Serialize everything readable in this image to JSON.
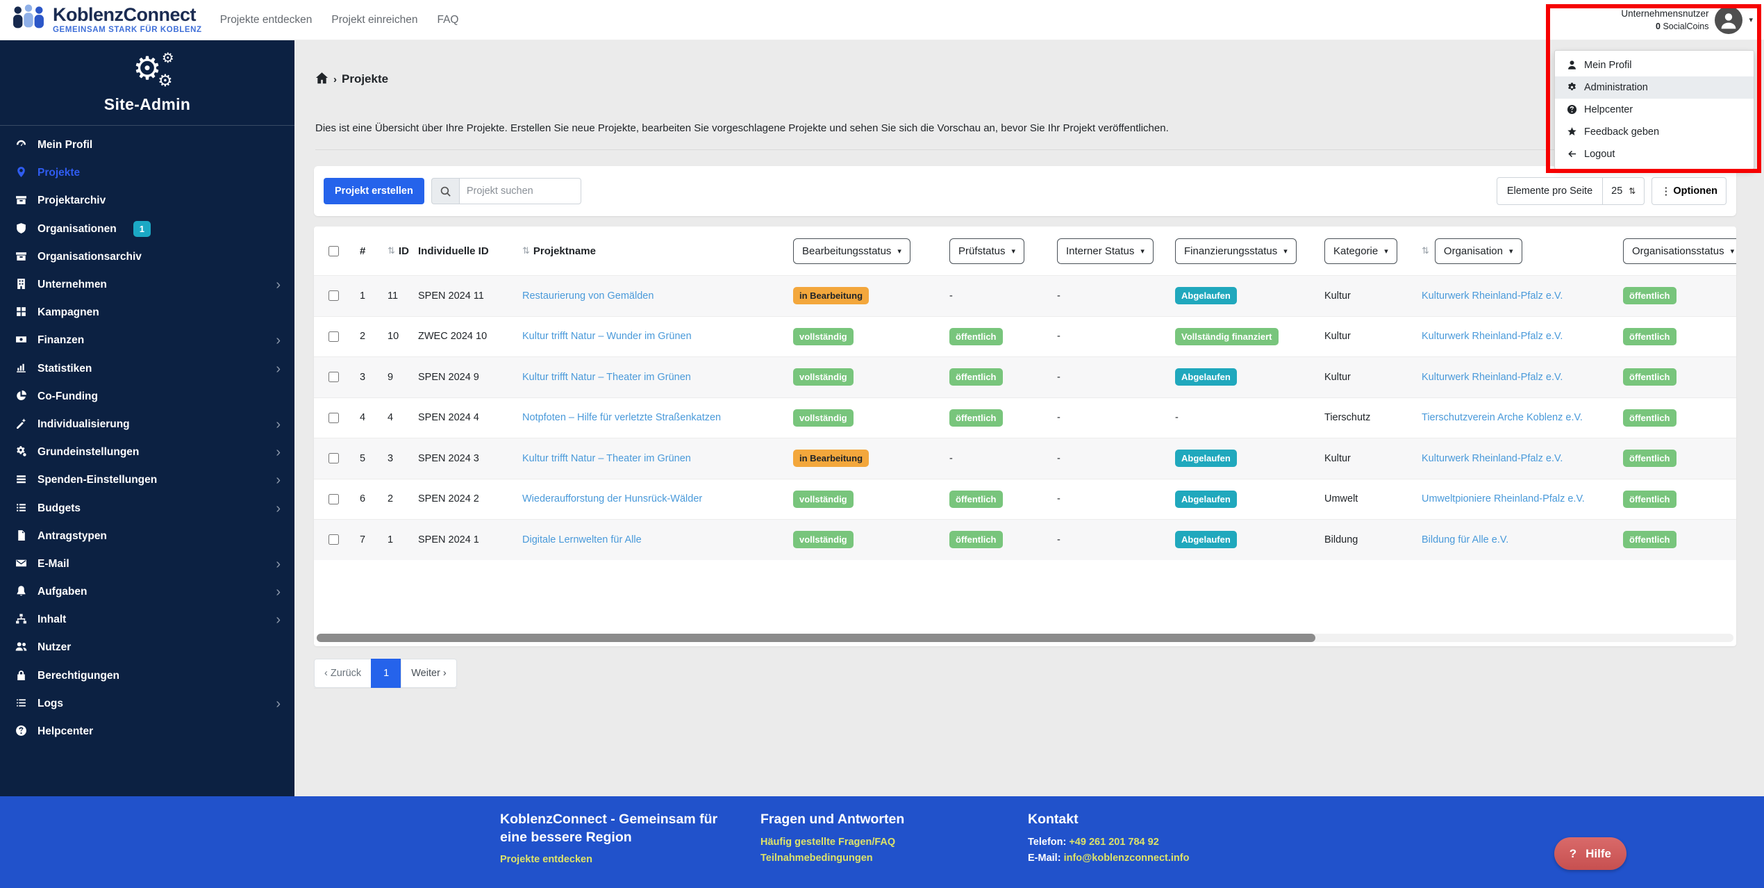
{
  "header": {
    "brand": {
      "name": "KoblenzConnect",
      "tagline": "GEMEINSAM STARK FÜR KOBLENZ"
    },
    "nav": [
      {
        "label": "Projekte entdecken"
      },
      {
        "label": "Projekt einreichen"
      },
      {
        "label": "FAQ"
      }
    ],
    "user": {
      "name": "Unternehmensnutzer",
      "coins_value": "0",
      "coins_label": " SocialCoins"
    }
  },
  "user_menu": {
    "items": [
      {
        "icon": "person",
        "label": "Mein Profil"
      },
      {
        "icon": "gear",
        "label": "Administration",
        "active": true
      },
      {
        "icon": "question",
        "label": "Helpcenter"
      },
      {
        "icon": "star",
        "label": "Feedback geben"
      },
      {
        "icon": "arrow-left",
        "label": "Logout"
      }
    ]
  },
  "sidebar": {
    "title": "Site-Admin",
    "items": [
      {
        "icon": "gauge",
        "label": "Mein Profil"
      },
      {
        "icon": "pin",
        "label": "Projekte",
        "active": true
      },
      {
        "icon": "archive",
        "label": "Projektarchiv"
      },
      {
        "icon": "shield",
        "label": "Organisationen",
        "badge": "1"
      },
      {
        "icon": "archive",
        "label": "Organisationsarchiv"
      },
      {
        "icon": "building",
        "label": "Unternehmen",
        "chevron": true
      },
      {
        "icon": "grid",
        "label": "Kampagnen"
      },
      {
        "icon": "money",
        "label": "Finanzen",
        "chevron": true
      },
      {
        "icon": "chart",
        "label": "Statistiken",
        "chevron": true
      },
      {
        "icon": "pie",
        "label": "Co-Funding"
      },
      {
        "icon": "wand",
        "label": "Individualisierung",
        "chevron": true
      },
      {
        "icon": "gears",
        "label": "Grundeinstellungen",
        "chevron": true
      },
      {
        "icon": "rows",
        "label": "Spenden-Einstellungen",
        "chevron": true
      },
      {
        "icon": "tasks",
        "label": "Budgets",
        "chevron": true
      },
      {
        "icon": "file",
        "label": "Antragstypen"
      },
      {
        "icon": "envelope",
        "label": "E-Mail",
        "chevron": true
      },
      {
        "icon": "bell",
        "label": "Aufgaben",
        "chevron": true
      },
      {
        "icon": "sitemap",
        "label": "Inhalt",
        "chevron": true
      },
      {
        "icon": "users",
        "label": "Nutzer"
      },
      {
        "icon": "lock",
        "label": "Berechtigungen"
      },
      {
        "icon": "list",
        "label": "Logs",
        "chevron": true
      },
      {
        "icon": "question",
        "label": "Helpcenter"
      }
    ]
  },
  "page": {
    "breadcrumb": "Projekte",
    "description": "Dies ist eine Übersicht über Ihre Projekte. Erstellen Sie neue Projekte, bearbeiten Sie vorgeschlagene Projekte und sehen Sie sich die Vorschau an, bevor Sie Ihr Projekt veröffentlichen.",
    "create_button": "Projekt erstellen",
    "search_placeholder": "Projekt suchen",
    "per_page_label": "Elemente pro Seite",
    "per_page_value": "25",
    "options_label": "Optionen",
    "pagination": {
      "prev": "‹ Zurück",
      "current": "1",
      "next": "Weiter ›"
    }
  },
  "table": {
    "columns": {
      "num": "#",
      "id": "ID",
      "indiv": "Individuelle ID",
      "name": "Projektname"
    },
    "filters": [
      "Bearbeitungsstatus",
      "Prüfstatus",
      "Interner Status",
      "Finanzierungsstatus",
      "Kategorie",
      "Organisation",
      "Organisationsstatus"
    ],
    "rows": [
      {
        "num": "1",
        "id": "11",
        "indiv": "SPEN 2024 11",
        "name": "Restaurierung von Gemälden",
        "bearbeitung": [
          "in Bearbeitung",
          "orange"
        ],
        "pruef": [
          "-",
          ""
        ],
        "intern": [
          "-",
          ""
        ],
        "finanz": [
          "Abgelaufen",
          "teal"
        ],
        "kategorie": "Kultur",
        "organisation": "Kulturwerk Rheinland-Pfalz e.V.",
        "orgstatus": [
          "öffentlich",
          "green"
        ]
      },
      {
        "num": "2",
        "id": "10",
        "indiv": "ZWEC 2024 10",
        "name": "Kultur trifft Natur – Wunder im Grünen",
        "bearbeitung": [
          "vollständig",
          "green"
        ],
        "pruef": [
          "öffentlich",
          "green"
        ],
        "intern": [
          "-",
          ""
        ],
        "finanz": [
          "Vollständig finanziert",
          "green"
        ],
        "kategorie": "Kultur",
        "organisation": "Kulturwerk Rheinland-Pfalz e.V.",
        "orgstatus": [
          "öffentlich",
          "green"
        ]
      },
      {
        "num": "3",
        "id": "9",
        "indiv": "SPEN 2024 9",
        "name": "Kultur trifft Natur – Theater im Grünen",
        "bearbeitung": [
          "vollständig",
          "green"
        ],
        "pruef": [
          "öffentlich",
          "green"
        ],
        "intern": [
          "-",
          ""
        ],
        "finanz": [
          "Abgelaufen",
          "teal"
        ],
        "kategorie": "Kultur",
        "organisation": "Kulturwerk Rheinland-Pfalz e.V.",
        "orgstatus": [
          "öffentlich",
          "green"
        ]
      },
      {
        "num": "4",
        "id": "4",
        "indiv": "SPEN 2024 4",
        "name": "Notpfoten – Hilfe für verletzte Straßenkatzen",
        "bearbeitung": [
          "vollständig",
          "green"
        ],
        "pruef": [
          "öffentlich",
          "green"
        ],
        "intern": [
          "-",
          ""
        ],
        "finanz": [
          "-",
          ""
        ],
        "kategorie": "Tierschutz",
        "organisation": "Tierschutzverein Arche Koblenz e.V.",
        "orgstatus": [
          "öffentlich",
          "green"
        ]
      },
      {
        "num": "5",
        "id": "3",
        "indiv": "SPEN 2024 3",
        "name": "Kultur trifft Natur – Theater im Grünen",
        "bearbeitung": [
          "in Bearbeitung",
          "orange"
        ],
        "pruef": [
          "-",
          ""
        ],
        "intern": [
          "-",
          ""
        ],
        "finanz": [
          "Abgelaufen",
          "teal"
        ],
        "kategorie": "Kultur",
        "organisation": "Kulturwerk Rheinland-Pfalz e.V.",
        "orgstatus": [
          "öffentlich",
          "green"
        ]
      },
      {
        "num": "6",
        "id": "2",
        "indiv": "SPEN 2024 2",
        "name": "Wiederaufforstung der Hunsrück-Wälder",
        "bearbeitung": [
          "vollständig",
          "green"
        ],
        "pruef": [
          "öffentlich",
          "green"
        ],
        "intern": [
          "-",
          ""
        ],
        "finanz": [
          "Abgelaufen",
          "teal"
        ],
        "kategorie": "Umwelt",
        "organisation": "Umweltpioniere Rheinland-Pfalz e.V.",
        "orgstatus": [
          "öffentlich",
          "green"
        ]
      },
      {
        "num": "7",
        "id": "1",
        "indiv": "SPEN 2024 1",
        "name": "Digitale Lernwelten für Alle",
        "bearbeitung": [
          "vollständig",
          "green"
        ],
        "pruef": [
          "öffentlich",
          "green"
        ],
        "intern": [
          "-",
          ""
        ],
        "finanz": [
          "Abgelaufen",
          "teal"
        ],
        "kategorie": "Bildung",
        "organisation": "Bildung für Alle e.V.",
        "orgstatus": [
          "öffentlich",
          "green"
        ]
      }
    ]
  },
  "footer": {
    "col1": {
      "title": "KoblenzConnect - Gemeinsam für eine bessere Region",
      "link": "Projekte entdecken"
    },
    "col2": {
      "title": "Fragen und Antworten",
      "links": [
        "Häufig gestellte Fragen/FAQ",
        "Teilnahmebedingungen"
      ]
    },
    "col3": {
      "title": "Kontakt",
      "phone_label": "Telefon:",
      "phone": "+49 261 201 784 92",
      "email_label": "E-Mail:",
      "email": "info@koblenzconnect.info"
    },
    "help": "Hilfe",
    "help_icon": "?"
  },
  "colors": {
    "primary_blue": "#2563eb",
    "sidebar_navy": "#0c2142",
    "active_item_blue": "#2f5cf0",
    "footer_blue": "#2152cb",
    "link_blue": "#4a9ada",
    "badge_green": "#78c57c",
    "badge_teal": "#20a8bd",
    "badge_orange": "#f3a73c",
    "count_badge_teal": "#1ba8c4",
    "annotation_red": "#f60000",
    "help_red": "#c75050",
    "page_bg": "#ebebeb"
  }
}
